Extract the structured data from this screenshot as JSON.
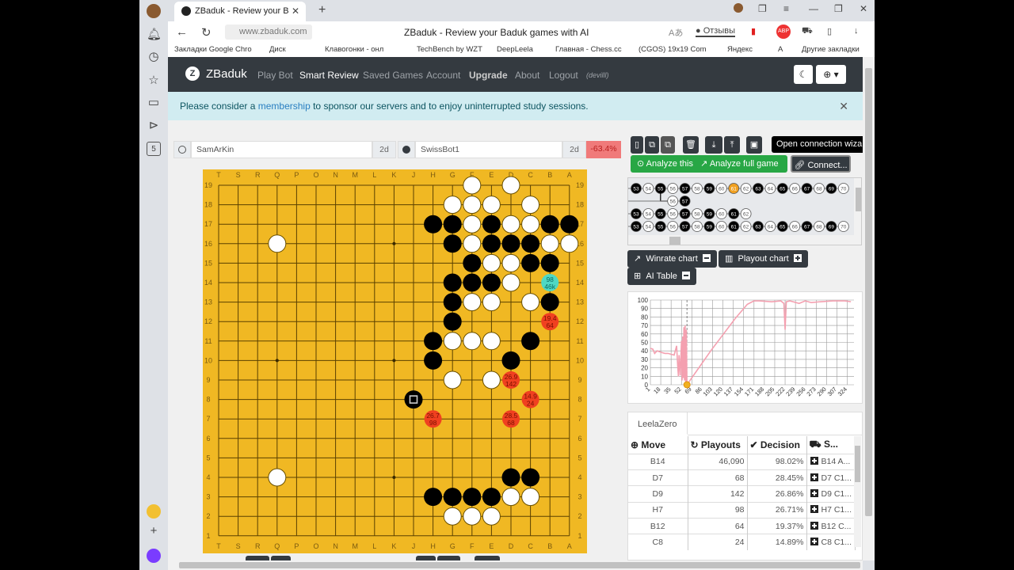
{
  "browser": {
    "tab_title": "ZBaduk - Review your B",
    "url": "www.zbaduk.com",
    "page_title": "ZBaduk - Review your Baduk games with AI",
    "feedback_label": "Отзывы",
    "bookmarks": [
      "Закладки Google Chro",
      "Диск",
      "Клавогонки - онл",
      "TechBench by WZT",
      "DeepLeela",
      "Главная - Chess.cc",
      "(CGOS) 19x19 Com",
      "Яндекс",
      "A",
      "Другие закладки"
    ]
  },
  "navbar": {
    "brand": "ZBaduk",
    "links": [
      "Play Bot",
      "Smart Review",
      "Saved Games",
      "Account",
      "Upgrade",
      "About",
      "Logout"
    ],
    "user": "(devilll)"
  },
  "alert": {
    "pre": "Please consider a ",
    "link": "membership",
    "post": " to sponsor our servers and to enjoy uninterrupted study sessions."
  },
  "players": {
    "white": {
      "name": "SamArKin",
      "rank": "2d"
    },
    "black": {
      "name": "SwissBot1",
      "rank": "2d",
      "winrate": "-63.4%"
    }
  },
  "board": {
    "cols": [
      "T",
      "S",
      "R",
      "Q",
      "P",
      "O",
      "N",
      "M",
      "L",
      "K",
      "J",
      "H",
      "G",
      "F",
      "E",
      "D",
      "C",
      "B",
      "A"
    ],
    "white": [
      "Q16",
      "Q4",
      "F19",
      "D19",
      "G18",
      "F18",
      "E18",
      "C18",
      "F17",
      "D17",
      "C17",
      "F16",
      "B16",
      "A16",
      "E15",
      "D15",
      "D14",
      "F13",
      "E13",
      "C13",
      "G11",
      "F11",
      "E11",
      "G9",
      "E9",
      "D3",
      "C3",
      "G2",
      "F2",
      "E2"
    ],
    "black": [
      "H17",
      "G17",
      "E17",
      "B17",
      "A17",
      "G16",
      "E16",
      "D16",
      "C16",
      "F15",
      "C15",
      "B15",
      "G14",
      "F14",
      "E14",
      "G13",
      "B13",
      "G12",
      "H11",
      "C11",
      "H10",
      "D10",
      "J8",
      "D4",
      "C4",
      "H3",
      "G3",
      "F3",
      "E3"
    ],
    "last_move": "J8",
    "suggestions": [
      {
        "pt": "B14",
        "l1": "98",
        "l2": "46k",
        "best": true
      },
      {
        "pt": "B12",
        "l1": "19.4",
        "l2": "64"
      },
      {
        "pt": "D9",
        "l1": "26.9",
        "l2": "142"
      },
      {
        "pt": "C8",
        "l1": "14.9",
        "l2": "24"
      },
      {
        "pt": "H7",
        "l1": "26.7",
        "l2": "98"
      },
      {
        "pt": "D7",
        "l1": "28.5",
        "l2": "68"
      }
    ]
  },
  "toolbar": {
    "tooltip": "Open connection wizard",
    "analyze_this": "Analyze this",
    "analyze_full": "Analyze full game",
    "connect": "Connect..."
  },
  "tree": {
    "rows": [
      {
        "start": 53,
        "end": 70,
        "current": 61
      },
      {
        "start": 56,
        "end": 57,
        "branch": true
      },
      {
        "start": 53,
        "end": 62
      },
      {
        "start": 53,
        "end": 70
      }
    ]
  },
  "panels": {
    "winrate": "Winrate chart",
    "playout": "Playout chart",
    "aitable": "AI Table"
  },
  "chart_data": {
    "type": "line",
    "title": "",
    "xlabel": "",
    "ylabel": "",
    "ylim": [
      0,
      100
    ],
    "yticks": [
      "0",
      "10",
      "20",
      "30",
      "40",
      "50",
      "60",
      "70",
      "80",
      "90",
      "100"
    ],
    "xticks": [
      "1",
      "18",
      "35",
      "52",
      "69",
      "86",
      "103",
      "120",
      "137",
      "154",
      "171",
      "188",
      "205",
      "222",
      "239",
      "256",
      "273",
      "290",
      "307",
      "324"
    ],
    "current_move": 61,
    "series": [
      {
        "name": "winrate",
        "color": "#f4a0b0",
        "x": [
          1,
          5,
          8,
          12,
          16,
          20,
          25,
          30,
          35,
          40,
          44,
          46,
          47,
          48,
          50,
          52,
          53,
          54,
          55,
          56,
          57,
          58,
          59,
          60,
          61,
          100,
          140,
          160,
          171,
          180,
          200,
          215,
          220,
          222,
          224,
          230,
          245,
          255,
          265,
          280,
          300,
          320,
          330
        ],
        "y": [
          43,
          42,
          37,
          40,
          39,
          38,
          37,
          37,
          36,
          35,
          46,
          20,
          10,
          35,
          11,
          52,
          5,
          57,
          8,
          68,
          5,
          70,
          2,
          65,
          0,
          40,
          78,
          95,
          99,
          99,
          98,
          99,
          96,
          65,
          98,
          99,
          96,
          99,
          97,
          98,
          99,
          99,
          98
        ]
      }
    ]
  },
  "ai_table": {
    "engine": "LeelaZero",
    "headers": [
      "Move",
      "Playouts",
      "Decision",
      "S..."
    ],
    "rows": [
      {
        "move": "B14",
        "playouts": "46,090",
        "decision": "98.02%",
        "seq": "B14 A..."
      },
      {
        "move": "D7",
        "playouts": "68",
        "decision": "28.45%",
        "seq": "D7 C1..."
      },
      {
        "move": "D9",
        "playouts": "142",
        "decision": "26.86%",
        "seq": "D9 C1..."
      },
      {
        "move": "H7",
        "playouts": "98",
        "decision": "26.71%",
        "seq": "H7 C1..."
      },
      {
        "move": "B12",
        "playouts": "64",
        "decision": "19.37%",
        "seq": "B12 C..."
      },
      {
        "move": "C8",
        "playouts": "24",
        "decision": "14.89%",
        "seq": "C8 C1..."
      }
    ]
  },
  "colors": {
    "accent_green": "#28a745",
    "dark": "#343a40",
    "board": "#f0b823",
    "suggest_best": "#4fd8c4",
    "suggest": "#f04020"
  }
}
